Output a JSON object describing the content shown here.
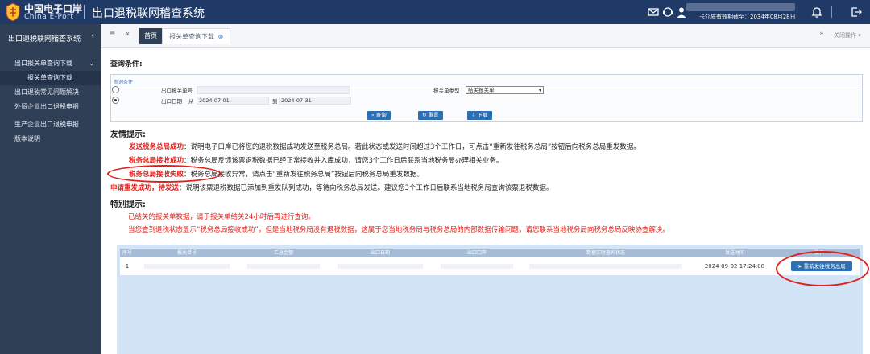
{
  "header": {
    "brand_cn": "中国电子口岸",
    "brand_en": "China E-Port",
    "system_title": "出口退税联网稽查系统",
    "validity_text": "卡介质有效期截至：2034年08月28日"
  },
  "sidebar": {
    "title": "出口退税联网稽查系统",
    "items": [
      {
        "label": "出口报关单查询下载"
      },
      {
        "label": "报关单查询下载"
      },
      {
        "label": "出口退税常见问题解决"
      },
      {
        "label": "外贸企业出口退税申报"
      },
      {
        "label": "生产企业出口退税申报"
      },
      {
        "label": "版本说明"
      }
    ]
  },
  "tabs": {
    "home": "首页",
    "current": "报关单查询下载",
    "close_ops": "关闭操作"
  },
  "query": {
    "heading": "查询条件:",
    "legend": "查询条件",
    "decl_no_label": "出口报关单号",
    "decl_type_label": "报关单类型",
    "decl_type_value": "结关报关单",
    "date_label": "出口日期",
    "from_label": "从",
    "from_value": "2024-07-01",
    "to_label": "到",
    "to_value": "2024-07-31",
    "btn_query": "查询",
    "btn_reset": "重置",
    "btn_download": "下载"
  },
  "tips": {
    "title": "友情提示:",
    "lines": [
      {
        "status": "发送税务总局成功",
        "text": "：说明电子口岸已将您的退税数据成功发送至税务总局。若此状态或发送时间超过3个工作日，可点击“重新发往税务总局”按钮后向税务总局重发数据。"
      },
      {
        "status": "税务总局接收成功",
        "text": "：税务总局反馈该票退税数据已经正常接收并入库成功，请您3个工作日后联系当地税务局办理相关业务。"
      },
      {
        "status": "税务总局接收失败",
        "text": "：税务总局接收异常，请点击“重新发往税务总局”按钮后向税务总局重发数据。"
      },
      {
        "status": "申请重发成功，待发送",
        "text": "：说明该票退税数据已添加到重发队列成功，等待向税务总局发送。建议您3个工作日后联系当地税务局查询该票退税数据。"
      }
    ]
  },
  "special": {
    "title": "特别提示:",
    "lines": [
      "已结关的报关单数据，请于报关单结关24小时后再进行查询。",
      "当您查到退税状态显示“税务总局接收成功”，但是当地税务局没有退税数据，这属于您当地税务局与税务总局的内部数据传输问题，请您联系当地税务局向税务总局反映协查解决。"
    ]
  },
  "table": {
    "headers": [
      "序号",
      "报关单号",
      "汇总金额",
      "出口日期",
      "出口口岸",
      "数据实时查询状态",
      "发送时间",
      "操作"
    ],
    "rows": [
      {
        "index": "1",
        "send_time": "2024-09-02 17:24:08",
        "action": "重新发往税务总局"
      }
    ]
  }
}
